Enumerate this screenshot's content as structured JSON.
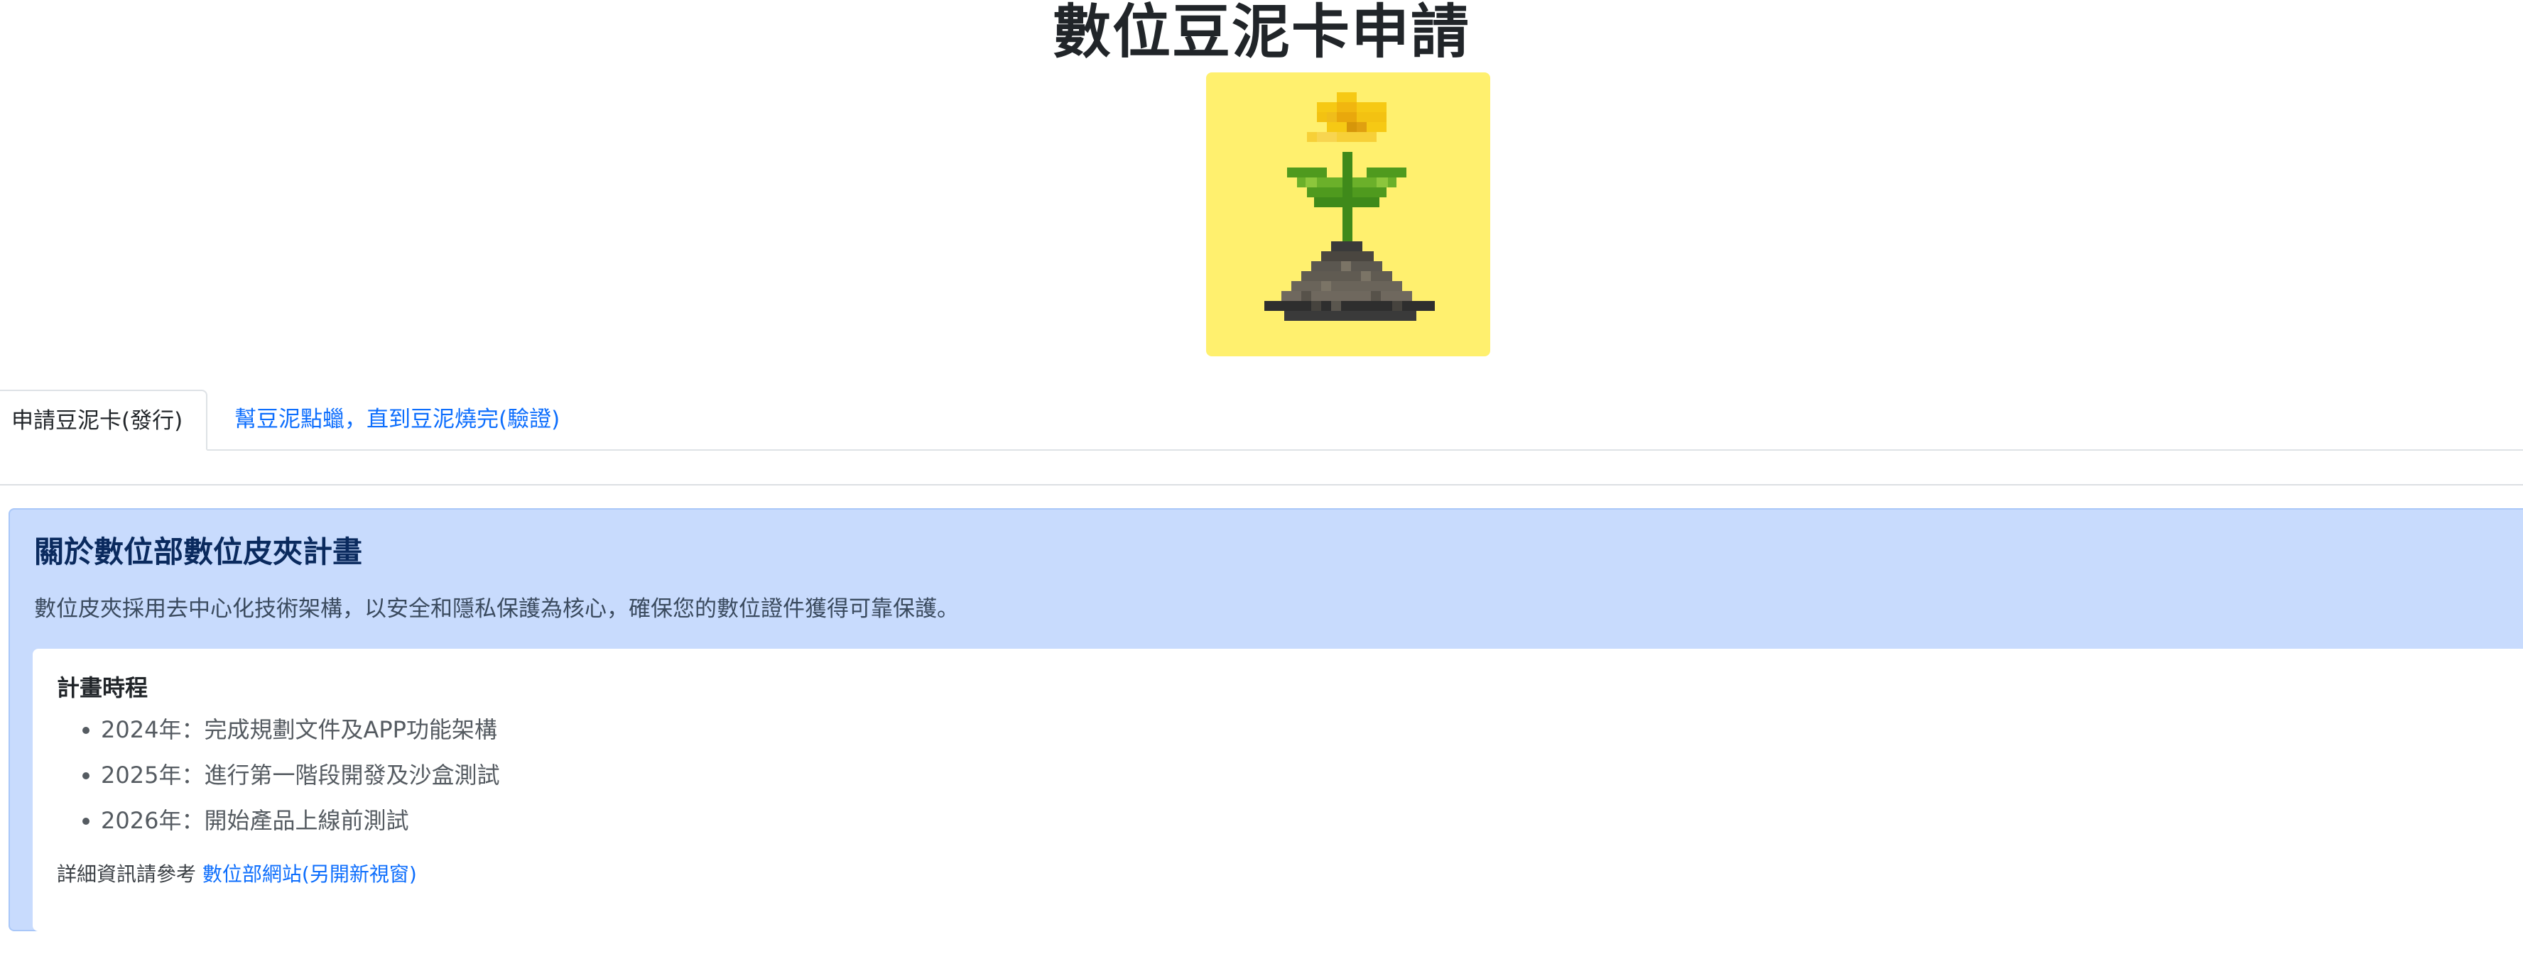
{
  "page": {
    "title": "數位豆泥卡申請"
  },
  "logo": {
    "icon": "pixel-flower-sprout-icon",
    "background_color": "#fff06e"
  },
  "tabs": [
    {
      "label": "申請豆泥卡(發行)",
      "active": true
    },
    {
      "label": "幫豆泥點蠟，直到豆泥燒完(驗證)",
      "active": false
    }
  ],
  "info": {
    "heading": "關於數位部數位皮夾計畫",
    "description": "數位皮夾採用去中心化技術架構，以安全和隱私保護為核心，確保您的數位證件獲得可靠保護。",
    "card": {
      "heading": "計畫時程",
      "timeline": [
        "2024年：完成規劃文件及APP功能架構",
        "2025年：進行第一階段開發及沙盒測試",
        "2026年：開始產品上線前測試"
      ],
      "reference_prefix": "詳細資訊請參考",
      "reference_link": "數位部網站(另開新視窗)"
    }
  },
  "colors": {
    "accent_link": "#0d6efd",
    "info_background": "#c8dbfd",
    "info_heading": "#0a2a5e"
  }
}
